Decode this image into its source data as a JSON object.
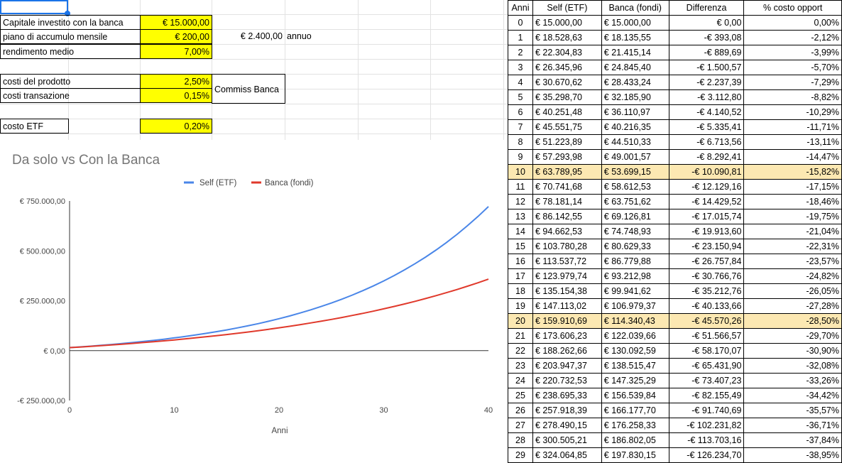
{
  "inputs": {
    "capital_label": "Capitale investito con la banca",
    "capital_value": "€ 15.000,00",
    "pac_label": "piano di accumulo mensile",
    "pac_value": "€ 200,00",
    "pac_annual_value": "€ 2.400,00",
    "pac_annual_label": "annuo",
    "return_label": "rendimento medio",
    "return_value": "7,00%",
    "product_cost_label": "costi del prodotto",
    "product_cost_value": "2,50%",
    "transaction_cost_label": "costi transazione",
    "transaction_cost_value": "0,15%",
    "bank_commission_label": "Commiss Banca",
    "etf_cost_label": "costo ETF",
    "etf_cost_value": "0,20%"
  },
  "table": {
    "headers": [
      "Anni",
      "Self (ETF)",
      "Banca (fondi)",
      "Differenza",
      "% costo opport"
    ],
    "highlight_years": [
      "10",
      "20"
    ],
    "rows": [
      [
        "0",
        "€ 15.000,00",
        "€ 15.000,00",
        "€ 0,00",
        "0,00%"
      ],
      [
        "1",
        "€ 18.528,63",
        "€ 18.135,55",
        "-€ 393,08",
        "-2,12%"
      ],
      [
        "2",
        "€ 22.304,83",
        "€ 21.415,14",
        "-€ 889,69",
        "-3,99%"
      ],
      [
        "3",
        "€ 26.345,96",
        "€ 24.845,40",
        "-€ 1.500,57",
        "-5,70%"
      ],
      [
        "4",
        "€ 30.670,62",
        "€ 28.433,24",
        "-€ 2.237,39",
        "-7,29%"
      ],
      [
        "5",
        "€ 35.298,70",
        "€ 32.185,90",
        "-€ 3.112,80",
        "-8,82%"
      ],
      [
        "6",
        "€ 40.251,48",
        "€ 36.110,97",
        "-€ 4.140,52",
        "-10,29%"
      ],
      [
        "7",
        "€ 45.551,75",
        "€ 40.216,35",
        "-€ 5.335,41",
        "-11,71%"
      ],
      [
        "8",
        "€ 51.223,89",
        "€ 44.510,33",
        "-€ 6.713,56",
        "-13,11%"
      ],
      [
        "9",
        "€ 57.293,98",
        "€ 49.001,57",
        "-€ 8.292,41",
        "-14,47%"
      ],
      [
        "10",
        "€ 63.789,95",
        "€ 53.699,15",
        "-€ 10.090,81",
        "-15,82%"
      ],
      [
        "11",
        "€ 70.741,68",
        "€ 58.612,53",
        "-€ 12.129,16",
        "-17,15%"
      ],
      [
        "12",
        "€ 78.181,14",
        "€ 63.751,62",
        "-€ 14.429,52",
        "-18,46%"
      ],
      [
        "13",
        "€ 86.142,55",
        "€ 69.126,81",
        "-€ 17.015,74",
        "-19,75%"
      ],
      [
        "14",
        "€ 94.662,53",
        "€ 74.748,93",
        "-€ 19.913,60",
        "-21,04%"
      ],
      [
        "15",
        "€ 103.780,28",
        "€ 80.629,33",
        "-€ 23.150,94",
        "-22,31%"
      ],
      [
        "16",
        "€ 113.537,72",
        "€ 86.779,88",
        "-€ 26.757,84",
        "-23,57%"
      ],
      [
        "17",
        "€ 123.979,74",
        "€ 93.212,98",
        "-€ 30.766,76",
        "-24,82%"
      ],
      [
        "18",
        "€ 135.154,38",
        "€ 99.941,62",
        "-€ 35.212,76",
        "-26,05%"
      ],
      [
        "19",
        "€ 147.113,02",
        "€ 106.979,37",
        "-€ 40.133,66",
        "-27,28%"
      ],
      [
        "20",
        "€ 159.910,69",
        "€ 114.340,43",
        "-€ 45.570,26",
        "-28,50%"
      ],
      [
        "21",
        "€ 173.606,23",
        "€ 122.039,66",
        "-€ 51.566,57",
        "-29,70%"
      ],
      [
        "22",
        "€ 188.262,66",
        "€ 130.092,59",
        "-€ 58.170,07",
        "-30,90%"
      ],
      [
        "23",
        "€ 203.947,37",
        "€ 138.515,47",
        "-€ 65.431,90",
        "-32,08%"
      ],
      [
        "24",
        "€ 220.732,53",
        "€ 147.325,29",
        "-€ 73.407,23",
        "-33,26%"
      ],
      [
        "25",
        "€ 238.695,33",
        "€ 156.539,84",
        "-€ 82.155,49",
        "-34,42%"
      ],
      [
        "26",
        "€ 257.918,39",
        "€ 166.177,70",
        "-€ 91.740,69",
        "-35,57%"
      ],
      [
        "27",
        "€ 278.490,15",
        "€ 176.258,33",
        "-€ 102.231,82",
        "-36,71%"
      ],
      [
        "28",
        "€ 300.505,21",
        "€ 186.802,05",
        "-€ 113.703,16",
        "-37,84%"
      ],
      [
        "29",
        "€ 324.064,85",
        "€ 197.830,15",
        "-€ 126.234,70",
        "-38,95%"
      ]
    ]
  },
  "colors": {
    "input_highlight": "#ffff00",
    "row_highlight": "#fce8b2",
    "self_series": "#4a86e8",
    "bank_series": "#e0392b",
    "selection": "#1a73e8"
  },
  "chart_data": {
    "type": "line",
    "title": "Da solo vs Con la Banca",
    "xlabel": "Anni",
    "ylabel": "",
    "xlim": [
      0,
      40
    ],
    "ylim": [
      -250000,
      750000
    ],
    "x_ticks": [
      "0",
      "10",
      "20",
      "30",
      "40"
    ],
    "y_ticks": [
      {
        "value": 750000,
        "label": "€ 750.000,00"
      },
      {
        "value": 500000,
        "label": "€ 500.000,00"
      },
      {
        "value": 250000,
        "label": "€ 250.000,00"
      },
      {
        "value": 0,
        "label": "€ 0,00"
      },
      {
        "value": -250000,
        "label": "-€ 250.000,00"
      }
    ],
    "legend": "top",
    "grid": false,
    "x": [
      0,
      1,
      2,
      3,
      4,
      5,
      6,
      7,
      8,
      9,
      10,
      11,
      12,
      13,
      14,
      15,
      16,
      17,
      18,
      19,
      20,
      21,
      22,
      23,
      24,
      25,
      26,
      27,
      28,
      29,
      30,
      31,
      32,
      33,
      34,
      35,
      36,
      37,
      38,
      39,
      40
    ],
    "series": [
      {
        "name": "Self (ETF)",
        "color": "#4a86e8",
        "values": [
          15000,
          18529,
          22305,
          26346,
          30671,
          35299,
          40251,
          45552,
          51224,
          57294,
          63790,
          70742,
          78181,
          86143,
          94663,
          103780,
          113538,
          123980,
          135154,
          147113,
          159911,
          173606,
          188263,
          203947,
          220733,
          238695,
          257918,
          278490,
          300505,
          324065,
          349273,
          376247,
          405109,
          435991,
          469035,
          504393,
          542225,
          582706,
          626021,
          672368,
          721958
        ]
      },
      {
        "name": "Banca (fondi)",
        "color": "#e0392b",
        "values": [
          15000,
          18136,
          21415,
          24845,
          28433,
          32186,
          36111,
          40216,
          44510,
          49002,
          53699,
          58613,
          63752,
          69127,
          74749,
          80629,
          86780,
          93213,
          99942,
          106979,
          114340,
          122040,
          130093,
          138515,
          147325,
          156540,
          166178,
          176258,
          186802,
          197830,
          209365,
          221430,
          234050,
          247250,
          261057,
          275498,
          290603,
          306402,
          322928,
          340213,
          358293
        ]
      }
    ]
  }
}
